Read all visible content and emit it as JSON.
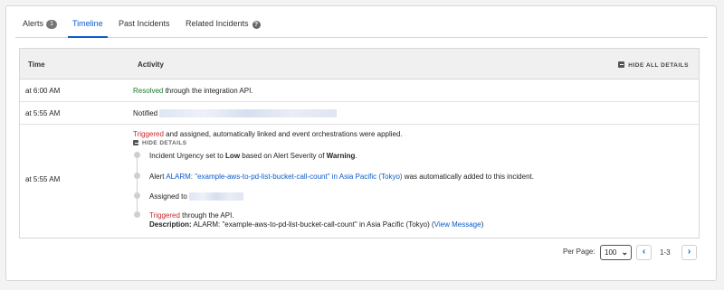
{
  "tabs": [
    {
      "label": "Alerts",
      "badge": "1"
    },
    {
      "label": "Timeline"
    },
    {
      "label": "Past Incidents"
    },
    {
      "label": "Related Incidents"
    }
  ],
  "table": {
    "col_time": "Time",
    "col_activity": "Activity",
    "hide_all": "HIDE ALL DETAILS",
    "rows": [
      {
        "time": "at 6:00 AM",
        "status": "Resolved",
        "text": " through the integration API."
      },
      {
        "time": "at 5:55 AM",
        "text": "Notified "
      },
      {
        "time": "at 5:55 AM",
        "status": "Triggered",
        "text": " and assigned, automatically linked and event orchestrations were applied.",
        "hide_details": "HIDE DETAILS",
        "details": {
          "urgency_pre": "Incident Urgency set to ",
          "urgency_value": "Low",
          "urgency_mid": " based on Alert Severity of ",
          "severity_value": "Warning",
          "urgency_end": ".",
          "alert_pre": "Alert ",
          "alert_link": "ALARM: \"example-aws-to-pd-list-bucket-call-count\" in Asia Pacific (Tokyo)",
          "alert_post": " was automatically added to this incident.",
          "assigned_pre": "Assigned to ",
          "trigger_status": "Triggered",
          "trigger_post": " through the API.",
          "desc_label": "Description:",
          "desc_text": " ALARM: \"example-aws-to-pd-list-bucket-call-count\" in Asia Pacific (Tokyo) (",
          "desc_link": "View Message",
          "desc_end": ")"
        }
      }
    ]
  },
  "pagination": {
    "per_page_label": "Per Page:",
    "per_page_value": "100",
    "prev": "‹",
    "range": "1-3",
    "next": "›"
  },
  "colors": {
    "accent": "#0b5bc8",
    "resolved": "#1b7a2f",
    "triggered": "#c8272d"
  }
}
